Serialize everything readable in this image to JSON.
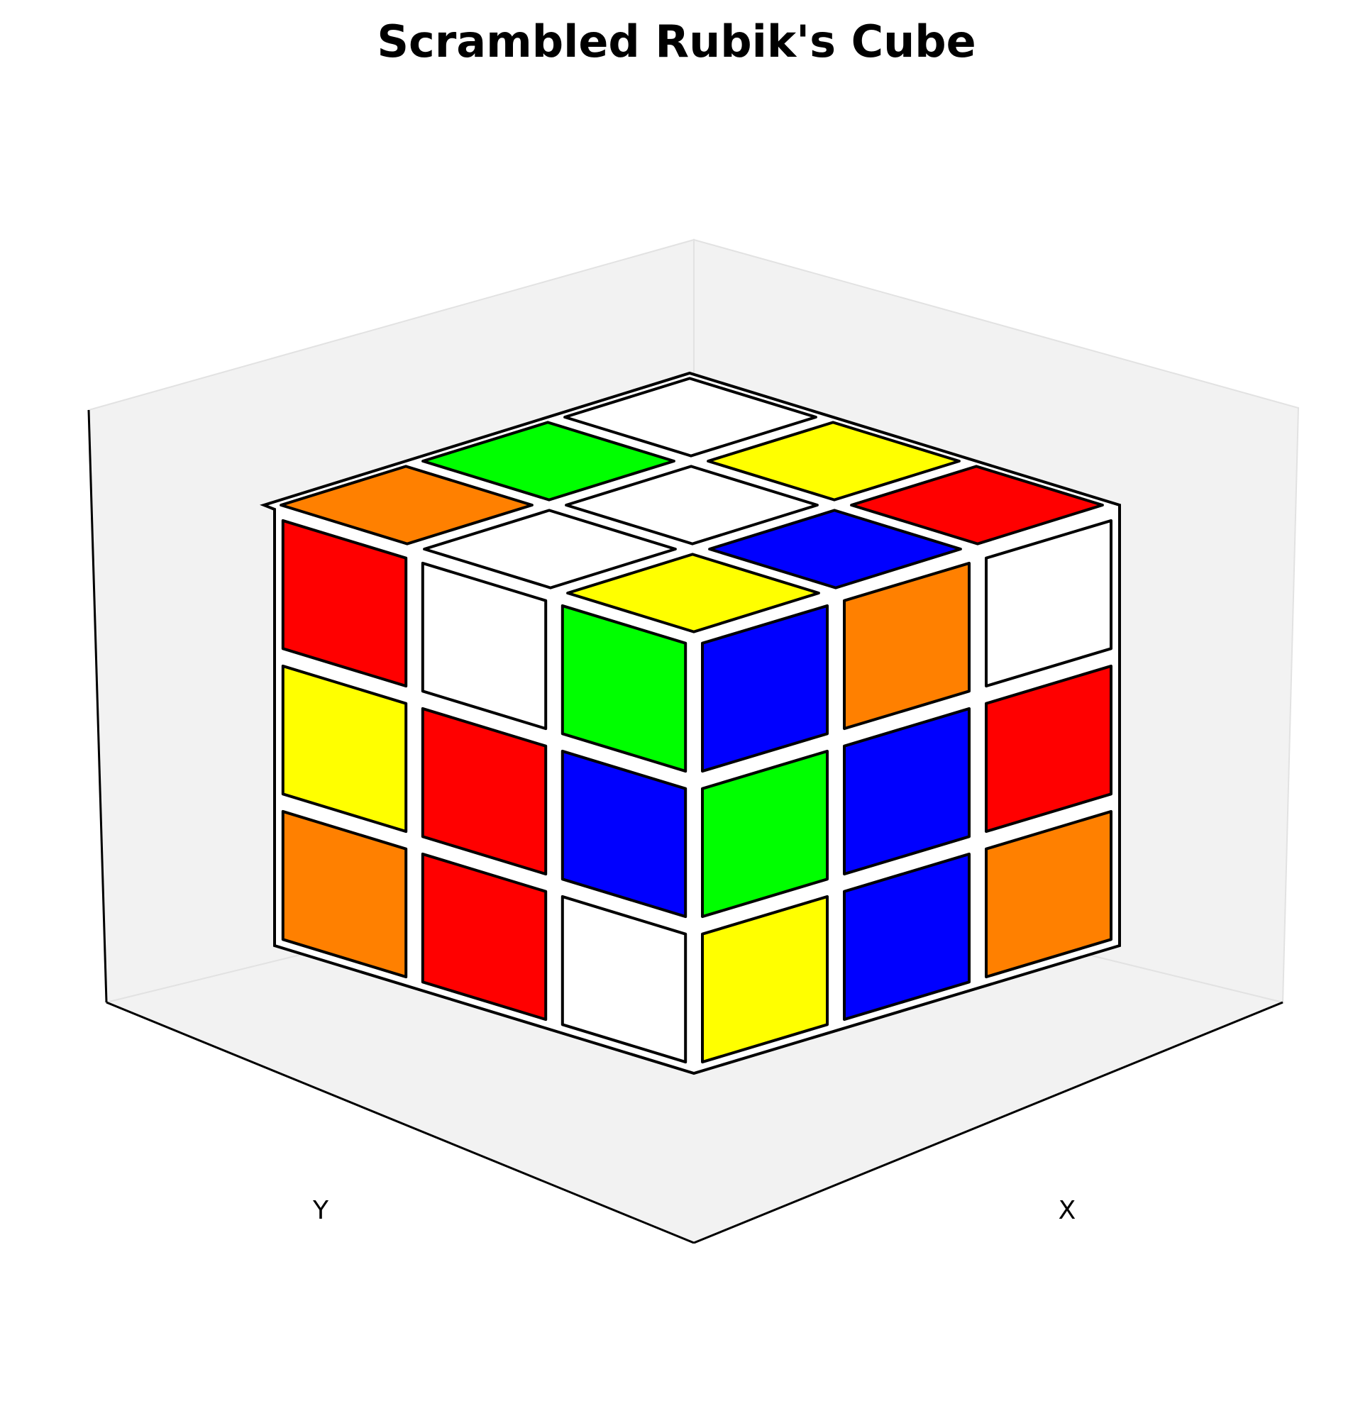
{
  "title": "Scrambled Rubik's Cube",
  "axes": {
    "xlabel": "X",
    "ylabel": "Y"
  },
  "palette": {
    "W": "#ffffff",
    "Y": "#ffff00",
    "R": "#ff0000",
    "O": "#ff8000",
    "B": "#0000ff",
    "G": "#00ff00"
  },
  "pane_color": "#f2f2f2",
  "cube": {
    "top": [
      [
        "O",
        "G",
        "W"
      ],
      [
        "W",
        "W",
        "Y"
      ],
      [
        "Y",
        "B",
        "R"
      ]
    ],
    "left_face": [
      [
        "R",
        "W",
        "G"
      ],
      [
        "Y",
        "R",
        "B"
      ],
      [
        "O",
        "R",
        "W"
      ]
    ],
    "right_face": [
      [
        "B",
        "O",
        "W"
      ],
      [
        "G",
        "B",
        "R"
      ],
      [
        "Y",
        "B",
        "O"
      ]
    ]
  }
}
